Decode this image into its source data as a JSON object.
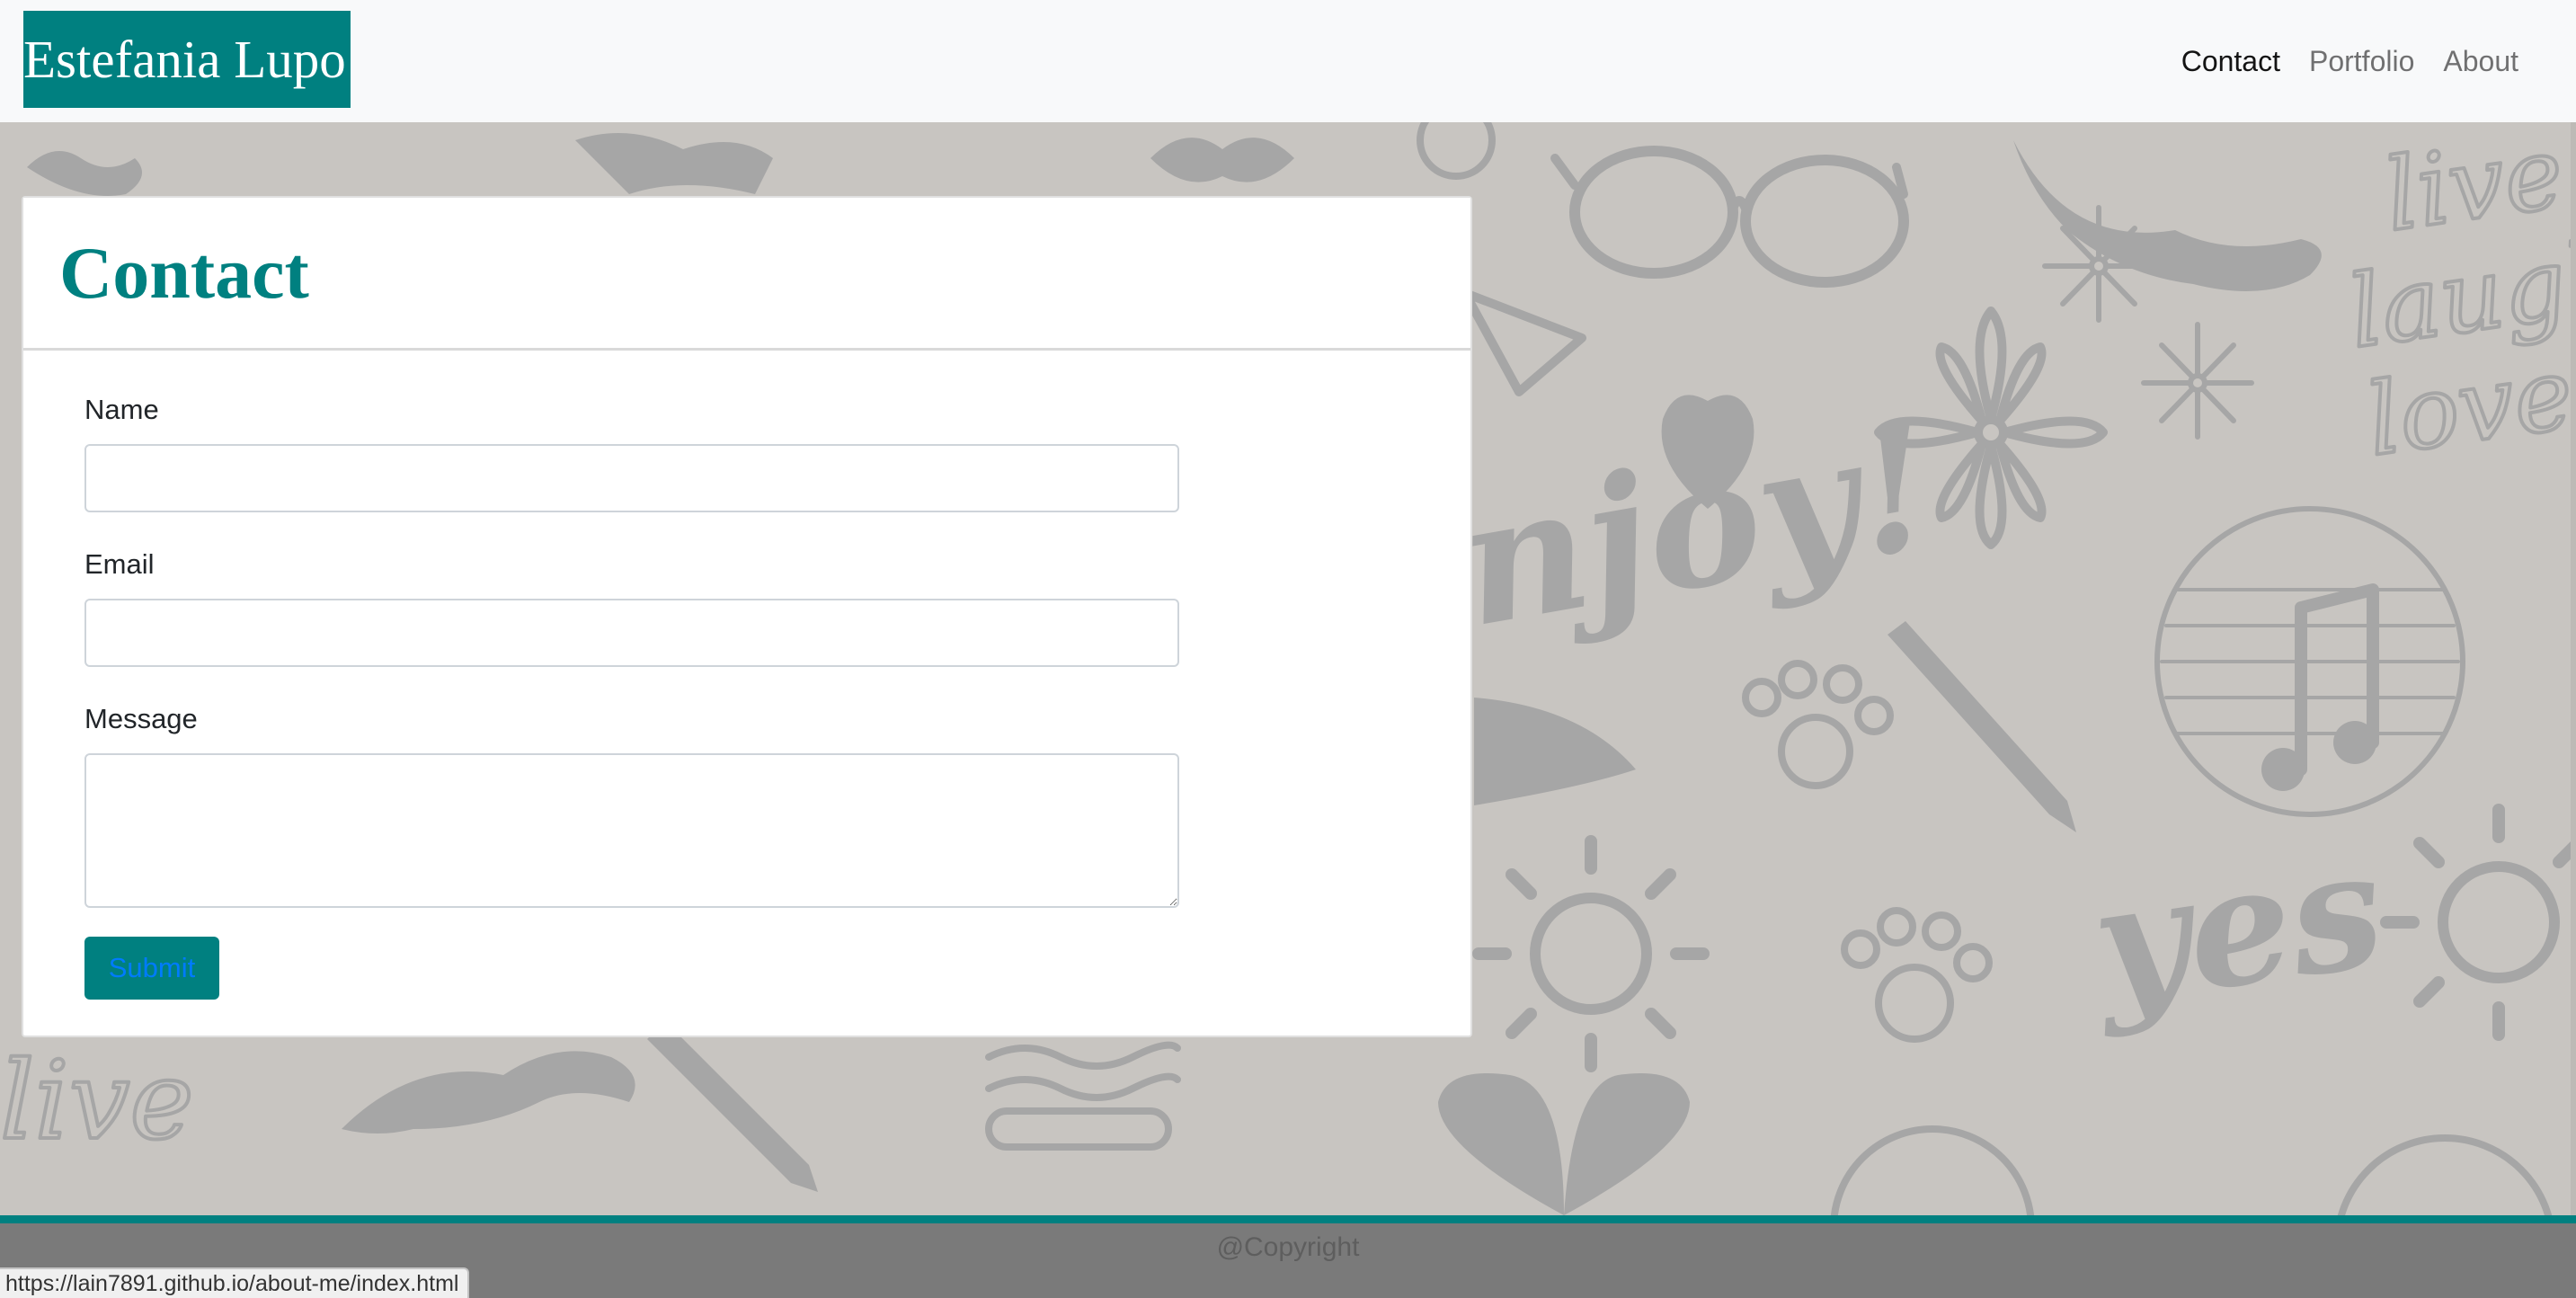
{
  "navbar": {
    "brand": "Estefania Lupo",
    "links": [
      {
        "label": "Contact",
        "active": true
      },
      {
        "label": "Portfolio",
        "active": false
      },
      {
        "label": "About",
        "active": false
      }
    ]
  },
  "background": {
    "doodle_words": [
      "live",
      "laugh",
      "love",
      "enjoy!",
      "yes",
      "love"
    ]
  },
  "contact_card": {
    "title": "Contact",
    "fields": {
      "name": {
        "label": "Name",
        "value": "",
        "placeholder": ""
      },
      "email": {
        "label": "Email",
        "value": "",
        "placeholder": ""
      },
      "message": {
        "label": "Message",
        "value": "",
        "placeholder": ""
      }
    },
    "submit_label": "Submit"
  },
  "footer": {
    "text": "@Copyright"
  },
  "status_bar": {
    "url": "https://lain7891.github.io/about-me/index.html"
  },
  "colors": {
    "brand_teal": "#008080",
    "navbar_bg": "#f8f9fa",
    "page_bg": "#c8c5c1",
    "footer_bg": "#7a7a7a",
    "submit_text": "#007bff"
  },
  "icons": [
    "heart-icon",
    "flower-icon",
    "sunglasses-icon",
    "mustache-icon",
    "paw-icon",
    "sun-icon",
    "pencil-icon",
    "music-note-icon"
  ]
}
